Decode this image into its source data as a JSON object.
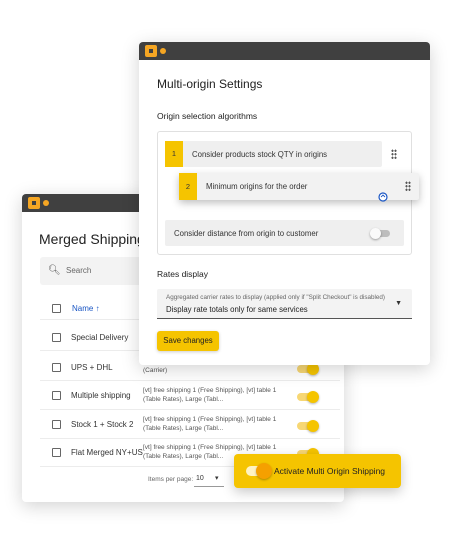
{
  "back_window": {
    "title": "Merged Shipping C",
    "search_placeholder": "Search",
    "column_name": "Name",
    "sort_icon": "arrow-up-icon",
    "rows": [
      {
        "name": "Special Delivery",
        "desc": ""
      },
      {
        "name": "UPS + DHL",
        "desc": "(Carrier)"
      },
      {
        "name": "Multiple shipping",
        "desc": "[vt] free shipping 1 (Free Shipping), [vt] table 1 (Table Rates), Large (Tabl..."
      },
      {
        "name": "Stock 1 + Stock 2",
        "desc": "[vt] free shipping 1 (Free Shipping), [vt] table 1 (Table Rates), Large (Tabl..."
      },
      {
        "name": "Flat Merged NY+US",
        "desc": "[vt] free shipping 1 (Free Shipping), [vt] table 1 (Table Rates), Large (Tabl..."
      }
    ],
    "pager": {
      "label": "Items per page:",
      "value": "10"
    }
  },
  "front_window": {
    "title": "Multi-origin Settings",
    "origin_section": "Origin selection algorithms",
    "algorithms": [
      {
        "num": "1",
        "label": "Consider products stock QTY in origins"
      },
      {
        "num": "2",
        "label": "Minimum origins for the order"
      }
    ],
    "distance_label": "Consider distance from origin to customer",
    "rates_section": "Rates display",
    "rates_select": {
      "caption": "Aggregated carrier rates to display (applied only if \"Split Checkout\" is disabled)",
      "value": "Display rate totals only for same services"
    },
    "save_label": "Save changes"
  },
  "activate": {
    "label": "Activate Multi Origin Shipping"
  },
  "colors": {
    "accent": "#f5c400",
    "titlebar": "#404040",
    "link": "#1a56c4"
  }
}
